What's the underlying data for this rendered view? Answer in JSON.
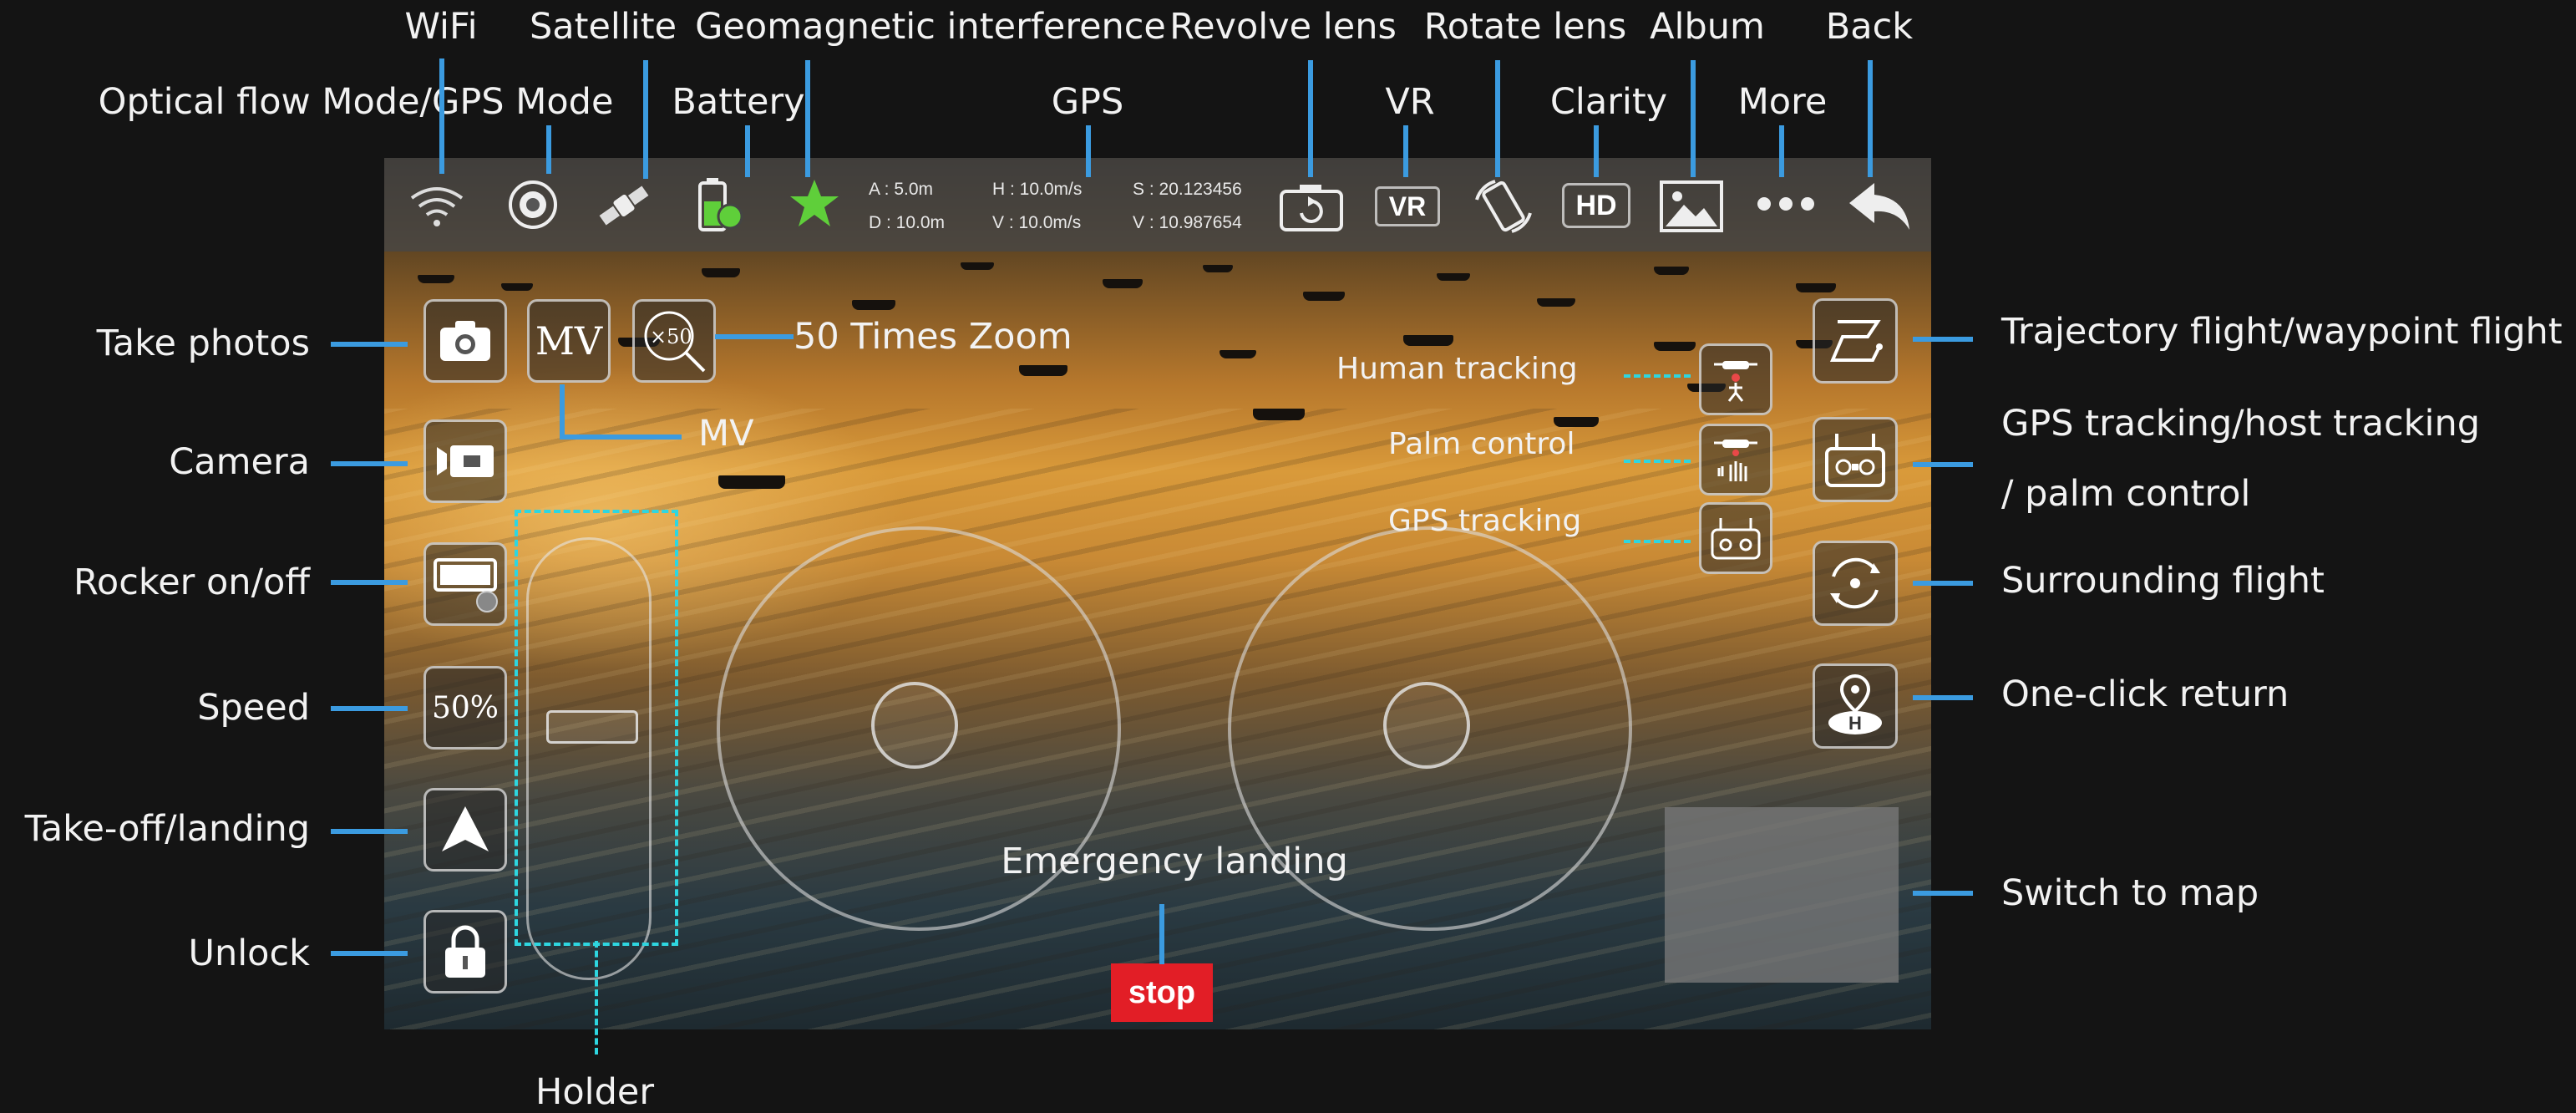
{
  "labels": {
    "wifi": "WiFi",
    "satellite": "Satellite",
    "geomagnetic": "Geomagnetic interference",
    "revolve_lens": "Revolve lens",
    "rotate_lens": "Rotate lens",
    "album": "Album",
    "back": "Back",
    "optical_flow": "Optical flow Mode/GPS Mode",
    "battery": "Battery",
    "gps": "GPS",
    "vr": "VR",
    "clarity": "Clarity",
    "more": "More",
    "take_photos": "Take photos",
    "camera": "Camera",
    "rocker": "Rocker on/off",
    "speed": "Speed",
    "takeoff": "Take-off/landing",
    "unlock": "Unlock",
    "holder": "Holder",
    "zoom": "50 Times Zoom",
    "mv": "MV",
    "human_tracking": "Human tracking",
    "palm_control": "Palm control",
    "gps_tracking": "GPS tracking",
    "trajectory": "Trajectory flight/waypoint flight",
    "gps_host_tracking_1": "GPS tracking/host tracking",
    "gps_host_tracking_2": "/ palm control",
    "surrounding": "Surrounding flight",
    "one_click_return": "One-click return",
    "switch_map": "Switch to map",
    "emergency": "Emergency landing"
  },
  "telemetry": {
    "a": "A : 5.0m",
    "d": "D : 10.0m",
    "h": "H : 10.0m/s",
    "v": "V : 10.0m/s",
    "s": "S : 20.123456",
    "v2": "V : 10.987654"
  },
  "buttons": {
    "mv": "MV",
    "zoom": "×50",
    "speed": "50%",
    "vr": "VR",
    "hd": "HD",
    "stop": "stop"
  },
  "colors": {
    "callout_line": "#3b9be0",
    "dashed_line": "#2ed6e0",
    "stop_red": "#e21e26",
    "geomagnetic_green": "#5fcf3a"
  }
}
